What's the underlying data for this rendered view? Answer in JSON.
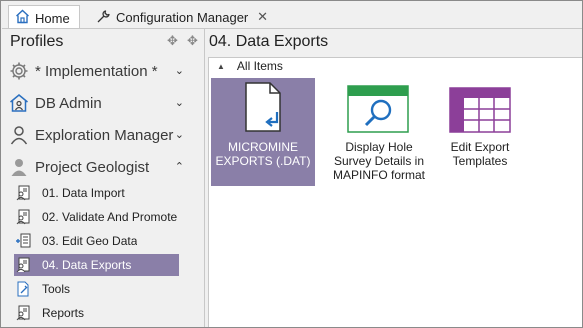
{
  "tabs": [
    {
      "label": "Home",
      "active": true,
      "icon": "home-icon"
    },
    {
      "label": "Configuration Manager",
      "active": false,
      "icon": "wrench-icon",
      "close": "✕"
    }
  ],
  "sidebar": {
    "title": "Profiles",
    "groups": [
      {
        "label": "* Implementation *",
        "icon": "gear-icon",
        "chevron": "⌄"
      },
      {
        "label": "DB Admin",
        "icon": "house-user-icon",
        "chevron": "⌄"
      },
      {
        "label": "Exploration Manager",
        "icon": "person-icon",
        "chevron": "⌄"
      },
      {
        "label": "Project Geologist",
        "icon": "person-icon",
        "chevron": "⌃"
      }
    ],
    "items": [
      {
        "label": "01. Data Import",
        "icon": "user-doc-icon"
      },
      {
        "label": "02. Validate And Promote",
        "icon": "user-doc-icon"
      },
      {
        "label": "03. Edit Geo Data",
        "icon": "edit-data-icon"
      },
      {
        "label": "04. Data Exports",
        "icon": "user-doc-icon",
        "selected": true
      },
      {
        "label": "Tools",
        "icon": "tools-icon"
      },
      {
        "label": "Reports",
        "icon": "user-doc-icon"
      }
    ]
  },
  "main": {
    "title": "04. Data Exports",
    "group_label": "All Items",
    "tiles": [
      {
        "label": "MICROMINE EXPORTS (.DAT)",
        "icon": "file-export-icon",
        "selected": true
      },
      {
        "label": "Display Hole Survey Details in MAPINFO format",
        "icon": "search-window-icon"
      },
      {
        "label": "Edit Export Templates",
        "icon": "table-icon"
      }
    ]
  },
  "colors": {
    "selection": "#8a7fa8",
    "accent_blue": "#1f6fbf",
    "green": "#2e9e4e",
    "purple": "#8c3f99"
  }
}
